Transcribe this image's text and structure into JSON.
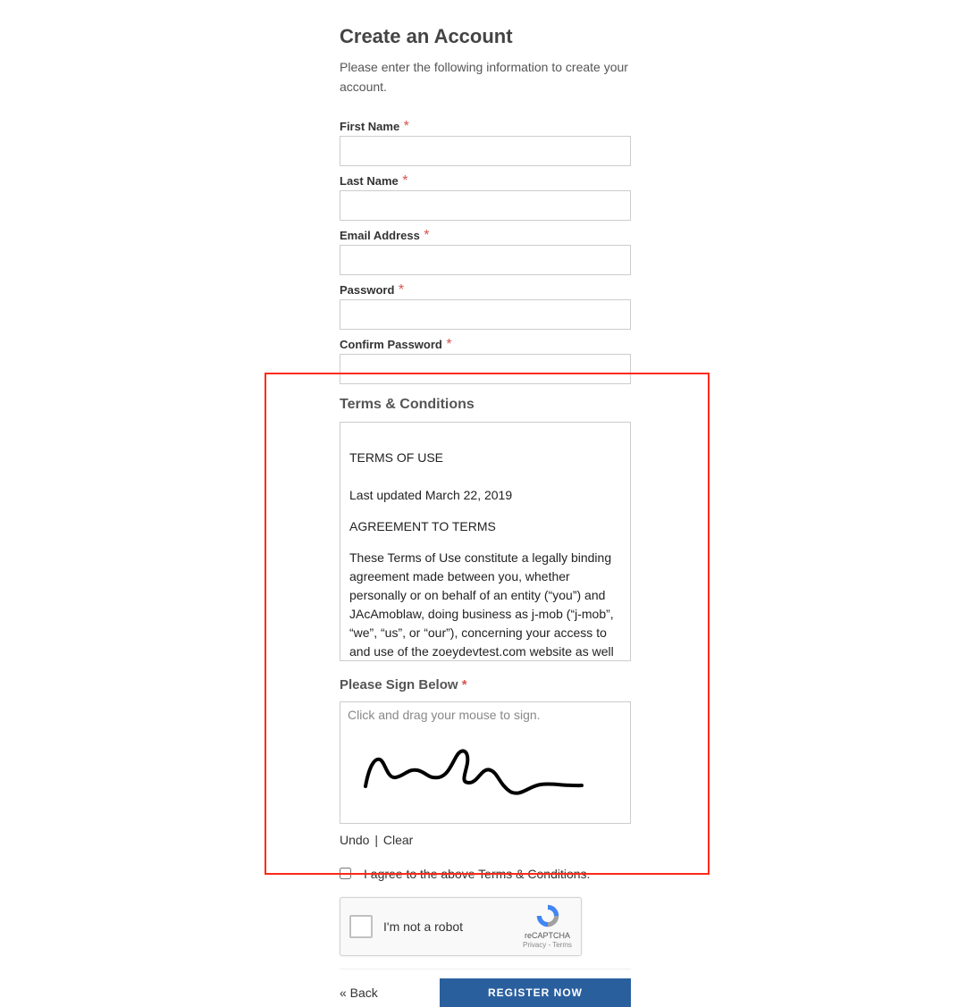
{
  "header": {
    "title": "Create an Account",
    "subtitle": "Please enter the following information to create your account."
  },
  "fields": {
    "first_name": {
      "label": "First Name",
      "value": ""
    },
    "last_name": {
      "label": "Last Name",
      "value": ""
    },
    "email": {
      "label": "Email Address",
      "value": ""
    },
    "password": {
      "label": "Password",
      "value": ""
    },
    "confirm_password": {
      "label": "Confirm Password",
      "value": ""
    }
  },
  "required_marker": "*",
  "terms": {
    "section_title": "Terms & Conditions",
    "line1": "TERMS OF USE",
    "line2": "Last updated March 22, 2019",
    "line3": "AGREEMENT TO TERMS",
    "body": "These Terms of Use constitute a legally binding agreement made between you, whether personally or on behalf of an entity (“you”) and JAcAmoblaw, doing business as j-mob (“j-mob”, “we”, “us”, or “our”), concerning your access to and use of the zoeydevtest.com website as well as any other media form, media channel, mobile website or mobile application related, linked, or otherwise connected thereto (collectively, the “Site”). You agree that by accessing the Site, you have read, understood, and agreed to be bound by all of these Terms of Use. IF"
  },
  "signature": {
    "title": "Please Sign Below",
    "hint": "Click and drag your mouse to sign.",
    "undo": "Undo",
    "clear": "Clear",
    "separator": "|"
  },
  "agree": {
    "label": "I agree to the above Terms & Conditions.",
    "checked": false
  },
  "recaptcha": {
    "label": "I'm not a robot",
    "brand": "reCAPTCHA",
    "legal": "Privacy - Terms"
  },
  "footer": {
    "back": "« Back",
    "register": "REGISTER NOW"
  }
}
